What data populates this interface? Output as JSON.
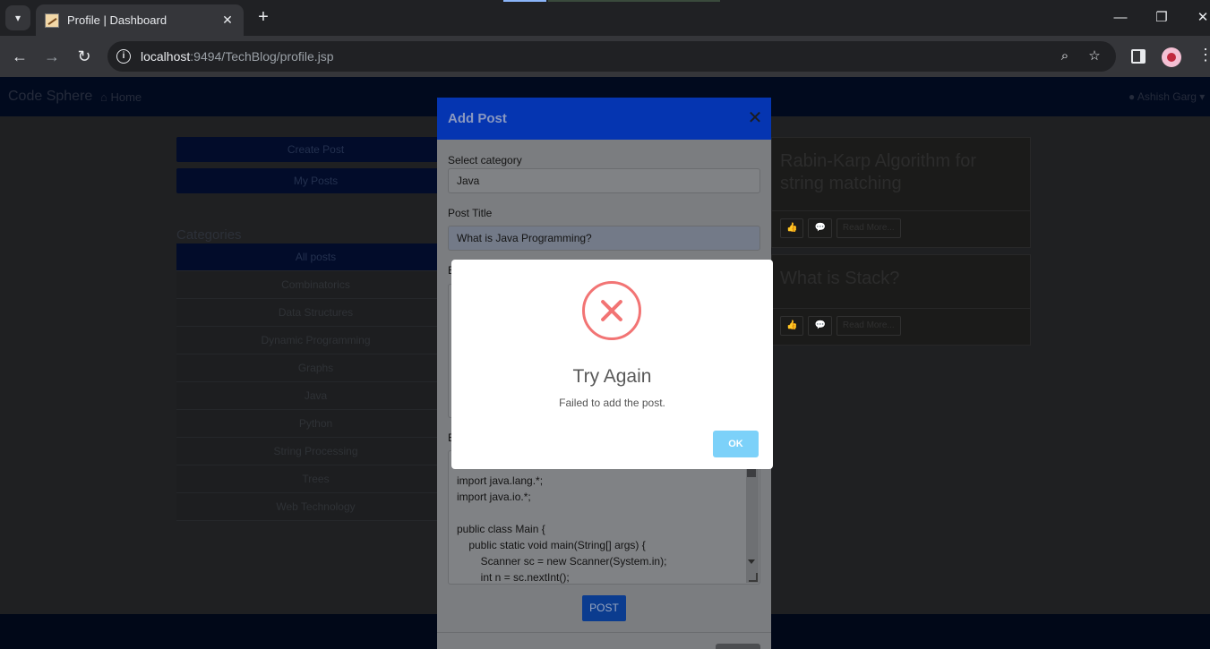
{
  "browser": {
    "tab_title": "Profile | Dashboard",
    "url_host": "localhost",
    "url_rest": ":9494/TechBlog/profile.jsp"
  },
  "navbar": {
    "brand": "Code Sphere",
    "home": "Home",
    "user": "Ashish Garg"
  },
  "sidebar": {
    "create_post": "Create Post",
    "my_posts": "My Posts",
    "categories_heading": "Categories",
    "categories": [
      "All posts",
      "Combinatorics",
      "Data Structures",
      "Dynamic Programming",
      "Graphs",
      "Java",
      "Python",
      "String Processing",
      "Trees",
      "Web Technology"
    ]
  },
  "posts": [
    {
      "title": "Rabin-Karp Algorithm for string matching",
      "read_more": "Read More..."
    },
    {
      "title": "What is Stack?",
      "read_more": "Read More..."
    }
  ],
  "modal": {
    "title": "Add Post",
    "category_label": "Select category",
    "category_value": "Java",
    "post_title_label": "Post Title",
    "post_title_value": "What is Java Programming?",
    "content_label": "E",
    "code_label": "E",
    "code_lines": [
      "import java.lang.*;",
      "import java.io.*;",
      "",
      "public class Main {",
      "    public static void main(String[] args) {",
      "        Scanner sc = new Scanner(System.in);",
      "        int n = sc.nextInt();"
    ],
    "post_button": "POST"
  },
  "alert": {
    "title": "Try Again",
    "text": "Failed to add the post.",
    "ok": "OK"
  }
}
